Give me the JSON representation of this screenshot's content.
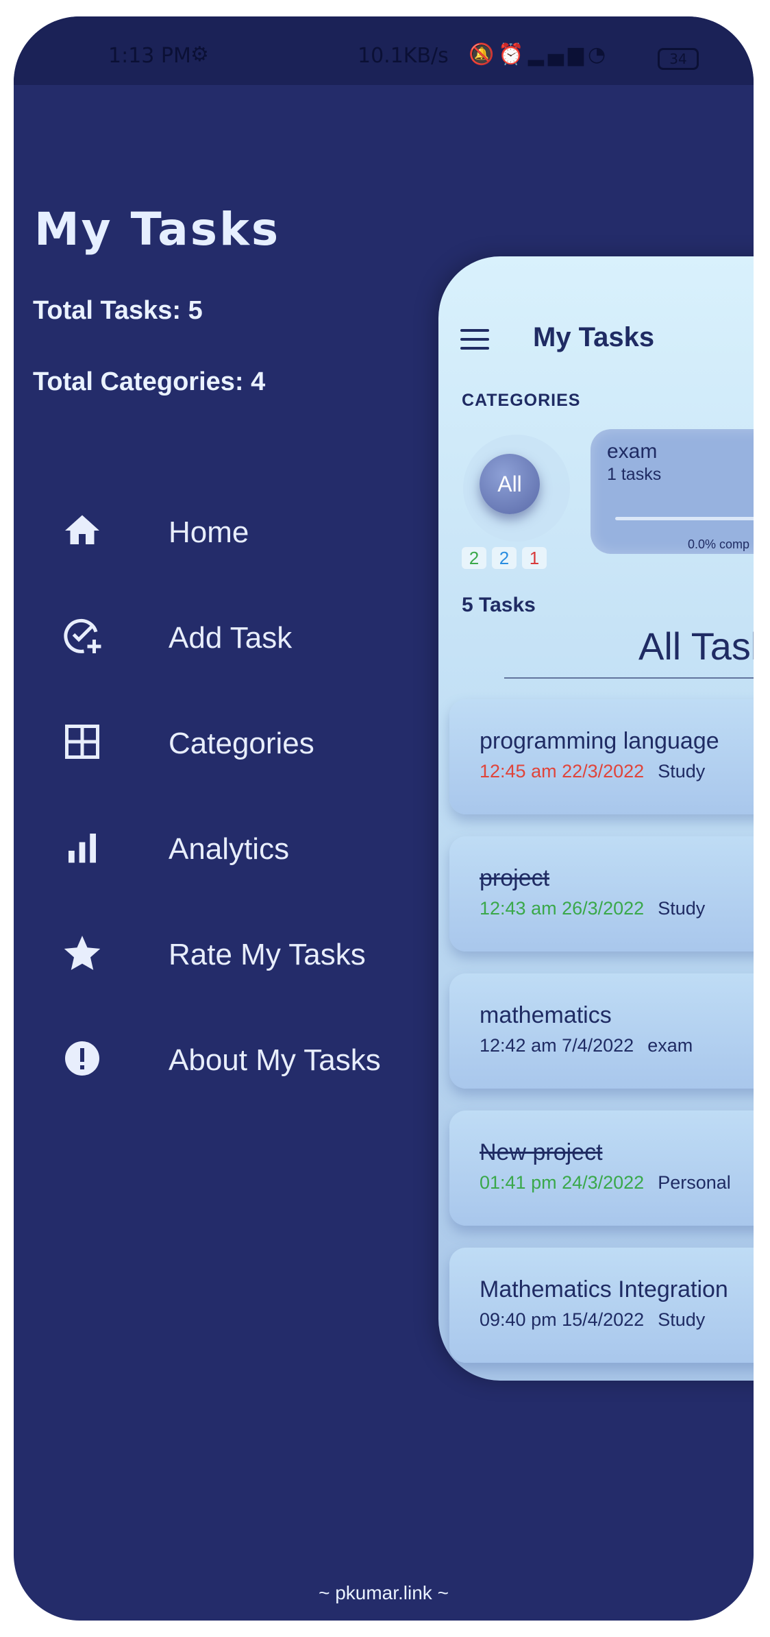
{
  "status_bar": {
    "time": "1:13 PM",
    "network_speed": "10.1KB/s",
    "battery": "34"
  },
  "drawer": {
    "title": "My Tasks",
    "total_tasks": "Total Tasks: 5",
    "total_categories": "Total Categories: 4",
    "menu": [
      {
        "label": "Home",
        "icon": "home-icon"
      },
      {
        "label": "Add Task",
        "icon": "add-task-icon"
      },
      {
        "label": "Categories",
        "icon": "grid-icon"
      },
      {
        "label": "Analytics",
        "icon": "bar-chart-icon"
      },
      {
        "label": "Rate My Tasks",
        "icon": "star-icon"
      },
      {
        "label": "About My Tasks",
        "icon": "info-alert-icon"
      }
    ]
  },
  "main": {
    "title": "My Tasks",
    "categories_label": "CATEGORIES",
    "all_button": "All",
    "badges": [
      "2",
      "2",
      "1"
    ],
    "category_card": {
      "name": "exam",
      "count": "1 tasks",
      "progress_text": "0.0% comp"
    },
    "task_count": "5 Tasks",
    "list_heading": "All Tasks",
    "tasks": [
      {
        "title": "programming language",
        "date": "12:45 am 22/3/2022",
        "category": "Study",
        "completed": false,
        "date_color": "#e0443a"
      },
      {
        "title": "project",
        "date": "12:43 am 26/3/2022",
        "category": "Study",
        "completed": true,
        "date_color": "#3aa84a"
      },
      {
        "title": "mathematics",
        "date": "12:42 am 7/4/2022",
        "category": "exam",
        "completed": false,
        "date_color": "#1f2b63"
      },
      {
        "title": "New project",
        "date": "01:41 pm 24/3/2022",
        "category": "Personal",
        "completed": true,
        "date_color": "#3aa84a"
      },
      {
        "title": "Mathematics Integration",
        "date": "09:40 pm 15/4/2022",
        "category": "Study",
        "completed": false,
        "date_color": "#1f2b63"
      }
    ]
  },
  "footer": "~ pkumar.link ~",
  "colors": {
    "background": "#242c6a",
    "panel": "#c3e0f5",
    "overdue": "#e0443a",
    "completed": "#3aa84a"
  }
}
